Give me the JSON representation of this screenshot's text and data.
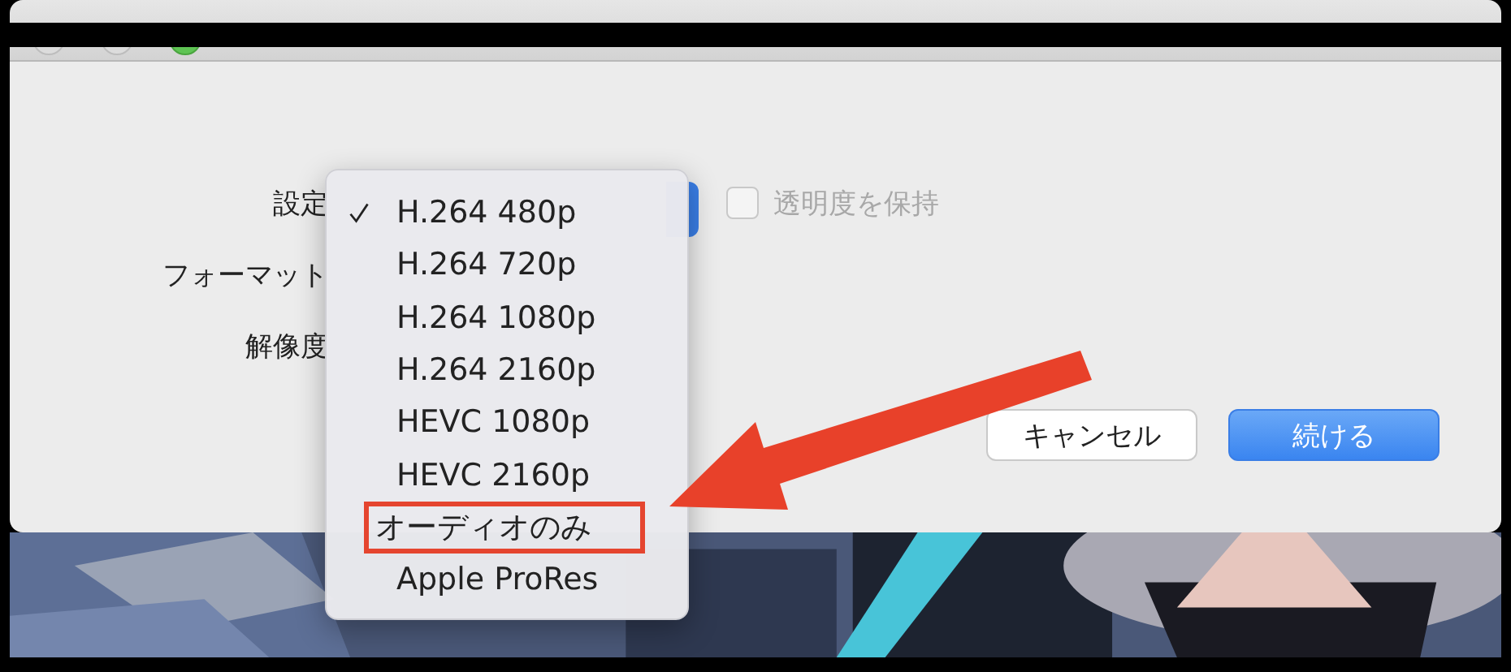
{
  "form": {
    "rows": [
      {
        "label": "設定"
      },
      {
        "label": "フォーマット"
      },
      {
        "label": "解像度"
      }
    ],
    "checkbox": {
      "label": "透明度を保持",
      "checked": false,
      "disabled": true
    }
  },
  "menu": {
    "items": [
      {
        "label": "H.264 480p",
        "selected": true,
        "marked": false
      },
      {
        "label": "H.264 720p",
        "selected": false,
        "marked": false
      },
      {
        "label": "H.264 1080p",
        "selected": false,
        "marked": false
      },
      {
        "label": "H.264 2160p",
        "selected": false,
        "marked": false
      },
      {
        "label": "HEVC 1080p",
        "selected": false,
        "marked": false
      },
      {
        "label": "HEVC 2160p",
        "selected": false,
        "marked": false
      },
      {
        "label": "オーディオのみ",
        "selected": false,
        "marked": true
      },
      {
        "label": "Apple ProRes",
        "selected": false,
        "marked": false
      }
    ]
  },
  "buttons": [
    {
      "label": "キャンセル",
      "kind": "secondary"
    },
    {
      "label": "続ける",
      "kind": "primary"
    }
  ]
}
